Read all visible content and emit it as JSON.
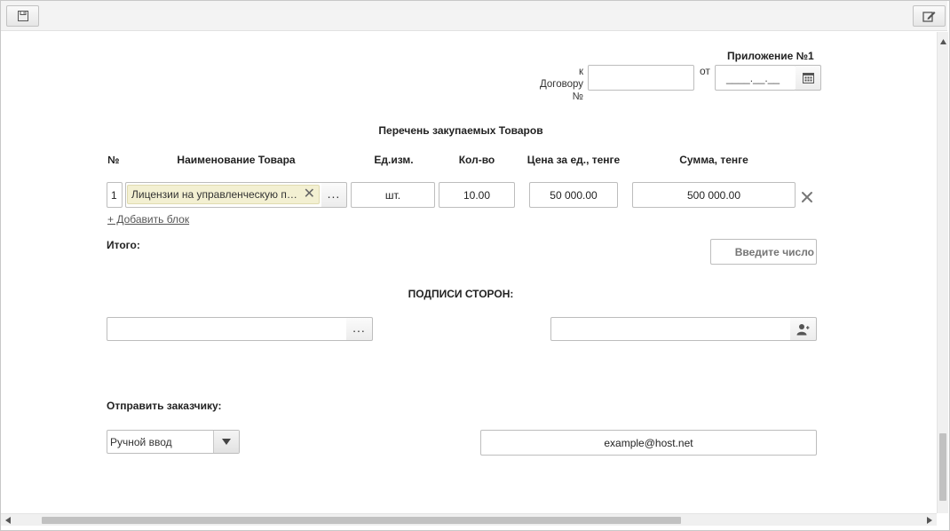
{
  "toolbar": {
    "save_icon": "save-icon",
    "edit_icon": "edit-icon"
  },
  "header": {
    "appendix_title": "Приложение №1",
    "contract_label_1": "к",
    "contract_label_2": "Договору",
    "contract_label_3": "№",
    "contract_number": "",
    "from_label": "от",
    "date_placeholder": "__.__.____",
    "date_display": "____.__.__"
  },
  "goods": {
    "title": "Перечень закупаемых Товаров",
    "columns": [
      "№",
      "Наименование Товара",
      "Ед.изм.",
      "Кол-во",
      "Цена за ед., тенге",
      "Сумма, тенге"
    ],
    "rows": [
      {
        "num": "1",
        "name": "Лицензии на управленческую пл...",
        "unit": "шт.",
        "qty": "10.00",
        "price": "50 000.00",
        "sum": "500 000.00"
      }
    ],
    "add_block_link": "+ Добавить блок",
    "total_label": "Итого:",
    "total_placeholder": "Введите число"
  },
  "signatures": {
    "title": "ПОДПИСИ СТОРОН:",
    "left_value": "",
    "right_value": ""
  },
  "send": {
    "label": "Отправить заказчику:",
    "mode_selected": "Ручной ввод",
    "email": "example@host.net"
  }
}
